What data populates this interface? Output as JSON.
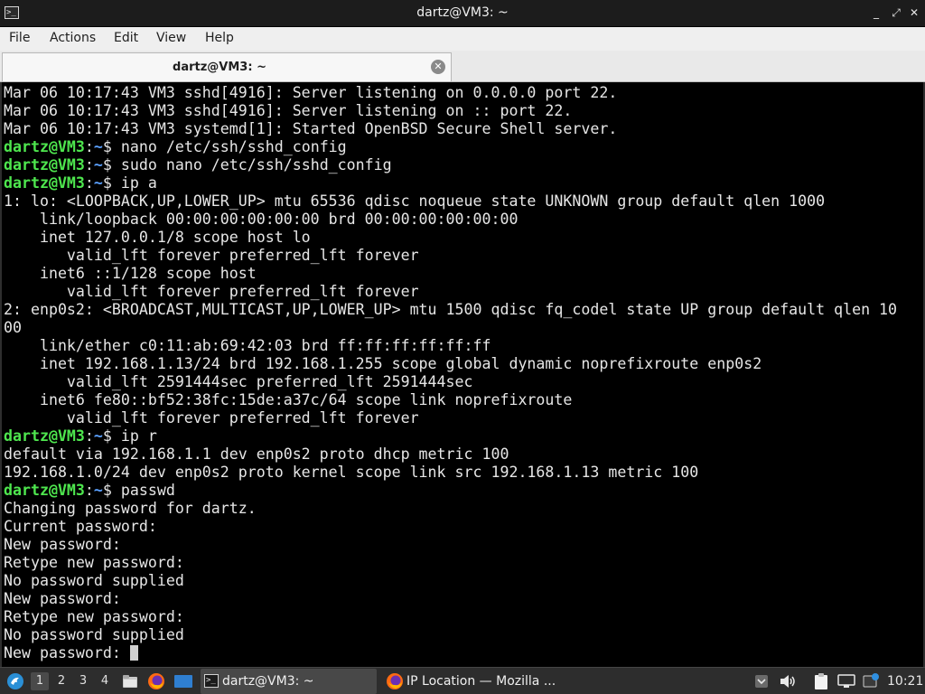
{
  "window": {
    "title": "dartz@VM3: ~",
    "controls": [
      "_",
      "⤢",
      "✕"
    ]
  },
  "menu": [
    "File",
    "Actions",
    "Edit",
    "View",
    "Help"
  ],
  "tab": {
    "label": "dartz@VM3: ~",
    "close": "✕"
  },
  "terminal": {
    "prompt_user": "dartz@VM3",
    "prompt_path": "~",
    "lines": [
      {
        "kind": "out",
        "text": "Mar 06 10:17:43 VM3 sshd[4916]: Server listening on 0.0.0.0 port 22."
      },
      {
        "kind": "out",
        "text": "Mar 06 10:17:43 VM3 sshd[4916]: Server listening on :: port 22."
      },
      {
        "kind": "out",
        "text": "Mar 06 10:17:43 VM3 systemd[1]: Started OpenBSD Secure Shell server."
      },
      {
        "kind": "cmd",
        "text": "nano /etc/ssh/sshd_config"
      },
      {
        "kind": "cmd",
        "text": "sudo nano /etc/ssh/sshd_config"
      },
      {
        "kind": "cmd",
        "text": "ip a"
      },
      {
        "kind": "out",
        "text": "1: lo: <LOOPBACK,UP,LOWER_UP> mtu 65536 qdisc noqueue state UNKNOWN group default qlen 1000"
      },
      {
        "kind": "out",
        "text": "    link/loopback 00:00:00:00:00:00 brd 00:00:00:00:00:00"
      },
      {
        "kind": "out",
        "text": "    inet 127.0.0.1/8 scope host lo"
      },
      {
        "kind": "out",
        "text": "       valid_lft forever preferred_lft forever"
      },
      {
        "kind": "out",
        "text": "    inet6 ::1/128 scope host"
      },
      {
        "kind": "out",
        "text": "       valid_lft forever preferred_lft forever"
      },
      {
        "kind": "out",
        "text": "2: enp0s2: <BROADCAST,MULTICAST,UP,LOWER_UP> mtu 1500 qdisc fq_codel state UP group default qlen 10"
      },
      {
        "kind": "out",
        "text": "00"
      },
      {
        "kind": "out",
        "text": "    link/ether c0:11:ab:69:42:03 brd ff:ff:ff:ff:ff:ff"
      },
      {
        "kind": "out",
        "text": "    inet 192.168.1.13/24 brd 192.168.1.255 scope global dynamic noprefixroute enp0s2"
      },
      {
        "kind": "out",
        "text": "       valid_lft 2591444sec preferred_lft 2591444sec"
      },
      {
        "kind": "out",
        "text": "    inet6 fe80::bf52:38fc:15de:a37c/64 scope link noprefixroute"
      },
      {
        "kind": "out",
        "text": "       valid_lft forever preferred_lft forever"
      },
      {
        "kind": "cmd",
        "text": "ip r"
      },
      {
        "kind": "out",
        "text": "default via 192.168.1.1 dev enp0s2 proto dhcp metric 100"
      },
      {
        "kind": "out",
        "text": "192.168.1.0/24 dev enp0s2 proto kernel scope link src 192.168.1.13 metric 100"
      },
      {
        "kind": "cmd",
        "text": "passwd"
      },
      {
        "kind": "out",
        "text": "Changing password for dartz."
      },
      {
        "kind": "out",
        "text": "Current password:"
      },
      {
        "kind": "out",
        "text": "New password:"
      },
      {
        "kind": "out",
        "text": "Retype new password:"
      },
      {
        "kind": "out",
        "text": "No password supplied"
      },
      {
        "kind": "out",
        "text": "New password:"
      },
      {
        "kind": "out",
        "text": "Retype new password:"
      },
      {
        "kind": "out",
        "text": "No password supplied"
      },
      {
        "kind": "input",
        "text": "New password: "
      }
    ]
  },
  "taskbar": {
    "workspaces": [
      "1",
      "2",
      "3",
      "4"
    ],
    "active_workspace": "1",
    "tasks": [
      {
        "label": "dartz@VM3: ~",
        "icon": "terminal-icon",
        "active": true
      },
      {
        "label": "IP Location — Mozilla ...",
        "icon": "firefox-icon",
        "active": false
      }
    ],
    "clock": "10:21"
  },
  "colors": {
    "prompt_user": "#4ee64e",
    "prompt_path": "#5aa0ff",
    "terminal_bg": "#000000",
    "terminal_fg": "#e6e6e6",
    "titlebar_bg": "#1c1c1c",
    "taskbar_bg": "#2d2d2d"
  }
}
